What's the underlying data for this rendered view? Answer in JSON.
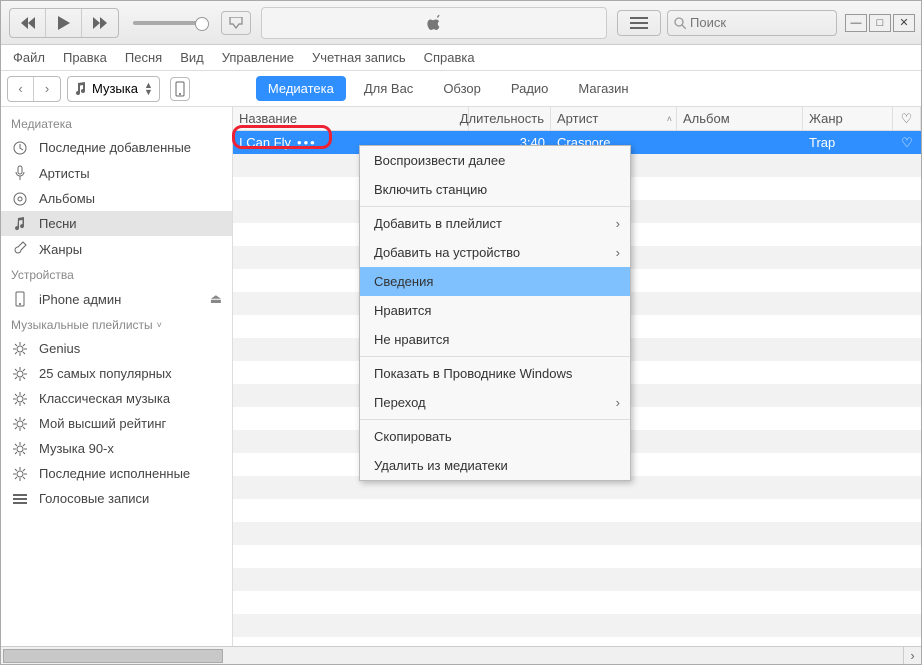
{
  "search": {
    "placeholder": "Поиск"
  },
  "menubar": [
    "Файл",
    "Правка",
    "Песня",
    "Вид",
    "Управление",
    "Учетная запись",
    "Справка"
  ],
  "mediaPicker": "Музыка",
  "tabs": [
    {
      "label": "Медиатека",
      "active": true
    },
    {
      "label": "Для Вас"
    },
    {
      "label": "Обзор"
    },
    {
      "label": "Радио"
    },
    {
      "label": "Магазин"
    }
  ],
  "sidebar": {
    "groups": [
      {
        "title": "Медиатека",
        "items": [
          {
            "icon": "clock",
            "label": "Последние добавленные"
          },
          {
            "icon": "mic",
            "label": "Артисты"
          },
          {
            "icon": "disc",
            "label": "Альбомы"
          },
          {
            "icon": "note",
            "label": "Песни",
            "sel": true
          },
          {
            "icon": "guitar",
            "label": "Жанры"
          }
        ]
      },
      {
        "title": "Устройства",
        "items": [
          {
            "icon": "phone",
            "label": "iPhone админ",
            "eject": true
          }
        ]
      },
      {
        "title": "Музыкальные плейлисты",
        "chev": true,
        "items": [
          {
            "icon": "gear",
            "label": "Genius"
          },
          {
            "icon": "gear",
            "label": "25 самых популярных"
          },
          {
            "icon": "gear",
            "label": "Классическая музыка"
          },
          {
            "icon": "gear",
            "label": "Мой высший рейтинг"
          },
          {
            "icon": "gear",
            "label": "Музыка 90-х"
          },
          {
            "icon": "gear",
            "label": "Последние исполненные"
          },
          {
            "icon": "bars",
            "label": "Голосовые записи"
          }
        ]
      }
    ]
  },
  "columns": {
    "name": "Название",
    "duration": "Длительность",
    "artist": "Артист",
    "album": "Альбом",
    "genre": "Жанр"
  },
  "track": {
    "name": "I Can Fly",
    "duration": "3:40",
    "artist": "Craspore",
    "album": "",
    "genre": "Trap"
  },
  "context": [
    {
      "t": "Воспроизвести далее"
    },
    {
      "t": "Включить станцию"
    },
    {
      "sep": true
    },
    {
      "t": "Добавить в плейлист",
      "sub": true
    },
    {
      "t": "Добавить на устройство",
      "sub": true
    },
    {
      "t": "Сведения",
      "hl": true
    },
    {
      "t": "Нравится"
    },
    {
      "t": "Не нравится"
    },
    {
      "sep": true
    },
    {
      "t": "Показать в Проводнике Windows"
    },
    {
      "t": "Переход",
      "sub": true
    },
    {
      "sep": true
    },
    {
      "t": "Скопировать"
    },
    {
      "t": "Удалить из медиатеки"
    }
  ]
}
